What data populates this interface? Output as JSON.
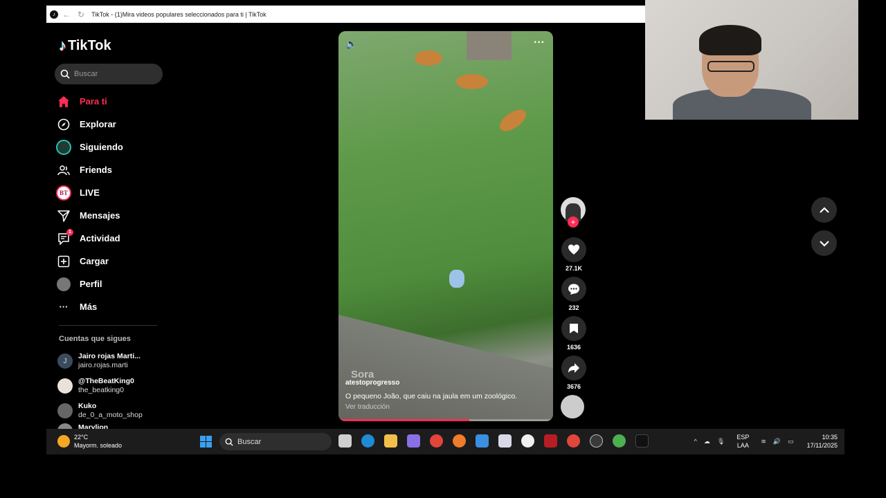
{
  "window": {
    "title": "TikTok - (1)Mira videos populares seleccionados para ti | TikTok"
  },
  "app": {
    "logo_text": "TikTok"
  },
  "search": {
    "placeholder": "Buscar"
  },
  "nav": [
    {
      "label": "Para ti",
      "icon": "home-icon",
      "active": true
    },
    {
      "label": "Explorar",
      "icon": "compass-icon"
    },
    {
      "label": "Siguiendo",
      "icon": "following-avatar-icon"
    },
    {
      "label": "Friends",
      "icon": "friends-icon"
    },
    {
      "label": "LIVE",
      "icon": "live-icon"
    },
    {
      "label": "Mensajes",
      "icon": "send-icon"
    },
    {
      "label": "Actividad",
      "icon": "activity-icon",
      "badge": "1"
    },
    {
      "label": "Cargar",
      "icon": "upload-icon"
    },
    {
      "label": "Perfil",
      "icon": "profile-avatar-icon"
    },
    {
      "label": "Más",
      "icon": "more-icon"
    }
  ],
  "following": {
    "title": "Cuentas que sigues",
    "accounts": [
      {
        "name": "Jairo rojas Marti...",
        "handle": "jairo.rojas.marti",
        "initial": "J"
      },
      {
        "name": "@TheBeatKing0",
        "handle": "the_beatking0",
        "initial": ""
      },
      {
        "name": "Kuko",
        "handle": "de_0_a_moto_shop",
        "initial": ""
      },
      {
        "name": "Marylion",
        "handle": "",
        "initial": ""
      }
    ]
  },
  "video": {
    "watermark": "Sora",
    "username": "atestoprogresso",
    "caption": "O pequeno João, que caiu na jaula em um zoológico.",
    "translate_label": "Ver traducción",
    "progress": 0.61
  },
  "actions": {
    "likes": "27.1K",
    "comments": "232",
    "saves": "1636",
    "shares": "3676"
  },
  "taskbar": {
    "temp": "22°C",
    "weather": "Mayorm. soleado",
    "search_label": "Buscar",
    "lang_top": "ESP",
    "lang_bottom": "LAA",
    "time": "10:35",
    "date": "17/11/2025"
  },
  "colors": {
    "accent": "#fe2c55"
  }
}
